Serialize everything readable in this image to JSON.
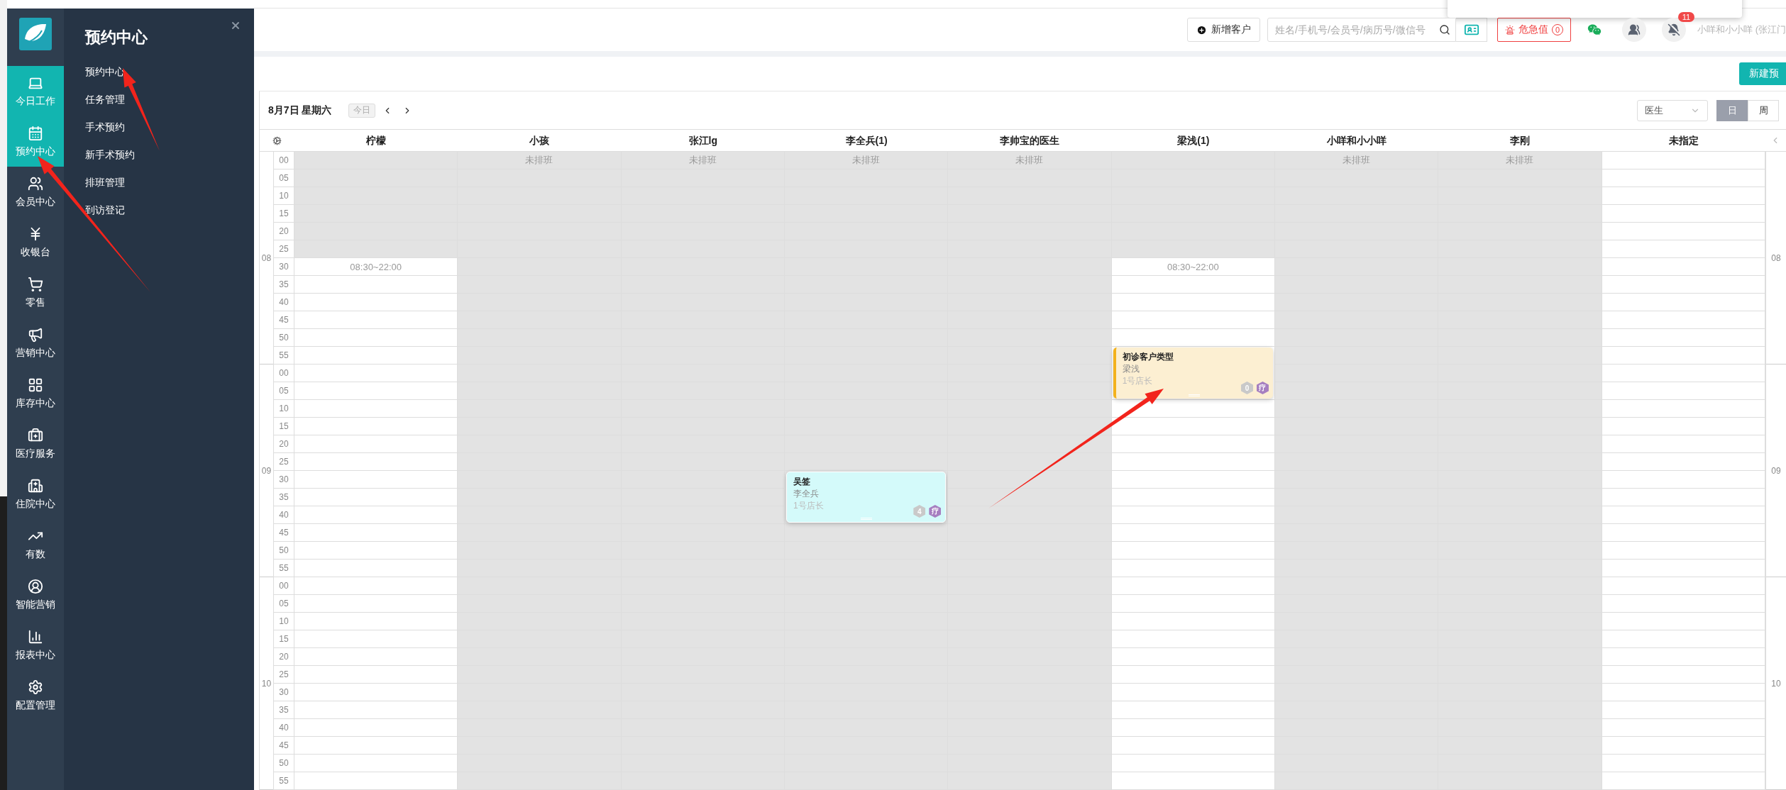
{
  "sidebar": {
    "rail": [
      {
        "label": "今日工作",
        "selected": true
      },
      {
        "label": "预约中心",
        "selected": true
      },
      {
        "label": "会员中心",
        "selected": false
      },
      {
        "label": "收银台",
        "selected": false
      },
      {
        "label": "零售",
        "selected": false
      },
      {
        "label": "营销中心",
        "selected": false
      },
      {
        "label": "库存中心",
        "selected": false
      },
      {
        "label": "医疗服务",
        "selected": false
      },
      {
        "label": "住院中心",
        "selected": false
      },
      {
        "label": "有数",
        "selected": false
      },
      {
        "label": "智能营销",
        "selected": false
      },
      {
        "label": "报表中心",
        "selected": false
      },
      {
        "label": "配置管理",
        "selected": false
      }
    ],
    "submenu": {
      "title": "预约中心",
      "items": [
        "预约中心",
        "任务管理",
        "手术预约",
        "新手术预约",
        "排班管理",
        "到访登记"
      ]
    }
  },
  "topbar": {
    "add_customer": "新增客户",
    "search": {
      "placeholder": "姓名/手机号/会员号/病历号/微信号"
    },
    "alert": {
      "label": "危急值",
      "count": "0"
    },
    "notifications": {
      "count": "11"
    },
    "user": "小咩和小小咩 (张江门"
  },
  "toolbar": {
    "new_button": "新建预"
  },
  "calendar": {
    "date": "8月7日 星期六",
    "today": {
      "label": "今日",
      "disabled": true
    },
    "view_select": "医生",
    "view_modes": [
      {
        "label": "日",
        "selected": true
      },
      {
        "label": "周",
        "selected": false
      }
    ],
    "columns": [
      {
        "name": "柠檬",
        "slots": [
          {
            "off": true
          },
          {
            "off": true
          },
          {
            "off": true
          },
          {
            "off": true
          },
          {
            "off": true
          },
          {
            "off": true
          },
          {
            "off": false,
            "note": "08:30~22:00"
          },
          {
            "off": false
          },
          {
            "off": false
          },
          {
            "off": false
          },
          {
            "off": false
          },
          {
            "off": false
          },
          {
            "off": false
          },
          {
            "off": false
          },
          {
            "off": false
          },
          {
            "off": false
          },
          {
            "off": false
          },
          {
            "off": false
          },
          {
            "off": false
          },
          {
            "off": false
          },
          {
            "off": false
          },
          {
            "off": false
          },
          {
            "off": false
          },
          {
            "off": false
          },
          {
            "off": false
          },
          {
            "off": false
          },
          {
            "off": false
          },
          {
            "off": false
          },
          {
            "off": false
          },
          {
            "off": false
          },
          {
            "off": false
          },
          {
            "off": false
          },
          {
            "off": false
          },
          {
            "off": false
          },
          {
            "off": false
          },
          {
            "off": false
          }
        ]
      },
      {
        "name": "小孩",
        "slots": [
          {
            "off": true,
            "note": "未排班"
          },
          {
            "off": true
          },
          {
            "off": true
          },
          {
            "off": true
          },
          {
            "off": true
          },
          {
            "off": true
          },
          {
            "off": true
          },
          {
            "off": true
          },
          {
            "off": true
          },
          {
            "off": true
          },
          {
            "off": true
          },
          {
            "off": true
          },
          {
            "off": true
          },
          {
            "off": true
          },
          {
            "off": true
          },
          {
            "off": true
          },
          {
            "off": true
          },
          {
            "off": true
          },
          {
            "off": true
          },
          {
            "off": true
          },
          {
            "off": true
          },
          {
            "off": true
          },
          {
            "off": true
          },
          {
            "off": true
          },
          {
            "off": true
          },
          {
            "off": true
          },
          {
            "off": true
          },
          {
            "off": true
          },
          {
            "off": true
          },
          {
            "off": true
          },
          {
            "off": true
          },
          {
            "off": true
          },
          {
            "off": true
          },
          {
            "off": true
          },
          {
            "off": true
          },
          {
            "off": true
          }
        ]
      },
      {
        "name": "张江lg",
        "slots": [
          {
            "off": true,
            "note": "未排班"
          },
          {
            "off": true
          },
          {
            "off": true
          },
          {
            "off": true
          },
          {
            "off": true
          },
          {
            "off": true
          },
          {
            "off": true
          },
          {
            "off": true
          },
          {
            "off": true
          },
          {
            "off": true
          },
          {
            "off": true
          },
          {
            "off": true
          },
          {
            "off": true
          },
          {
            "off": true
          },
          {
            "off": true
          },
          {
            "off": true
          },
          {
            "off": true
          },
          {
            "off": true
          },
          {
            "off": true
          },
          {
            "off": true
          },
          {
            "off": true
          },
          {
            "off": true
          },
          {
            "off": true
          },
          {
            "off": true
          },
          {
            "off": true
          },
          {
            "off": true
          },
          {
            "off": true
          },
          {
            "off": true
          },
          {
            "off": true
          },
          {
            "off": true
          },
          {
            "off": true
          },
          {
            "off": true
          },
          {
            "off": true
          },
          {
            "off": true
          },
          {
            "off": true
          },
          {
            "off": true
          }
        ]
      },
      {
        "name": "李全兵(1)",
        "slots": [
          {
            "off": true,
            "note": "未排班"
          },
          {
            "off": true
          },
          {
            "off": true
          },
          {
            "off": true
          },
          {
            "off": true
          },
          {
            "off": true
          },
          {
            "off": true
          },
          {
            "off": true
          },
          {
            "off": true
          },
          {
            "off": true
          },
          {
            "off": true
          },
          {
            "off": true
          },
          {
            "off": true
          },
          {
            "off": true
          },
          {
            "off": true
          },
          {
            "off": true
          },
          {
            "off": true
          },
          {
            "off": true
          },
          {
            "off": true,
            "appointment": {
              "title": "吴签",
              "doctor": "李全兵",
              "role": "1号店长",
              "count": "4",
              "tag": "疗",
              "kind": "normal",
              "color": "#d4fafa"
            }
          },
          {
            "off": true
          },
          {
            "off": true
          },
          {
            "off": true
          },
          {
            "off": true
          },
          {
            "off": true
          },
          {
            "off": true
          },
          {
            "off": true
          },
          {
            "off": true
          },
          {
            "off": true
          },
          {
            "off": true
          },
          {
            "off": true
          },
          {
            "off": true
          },
          {
            "off": true
          },
          {
            "off": true
          },
          {
            "off": true
          }
        ]
      },
      {
        "name": "李帅宝的医生",
        "slots": [
          {
            "off": true,
            "note": "未排班"
          },
          {
            "off": true
          },
          {
            "off": true
          },
          {
            "off": true
          },
          {
            "off": true
          },
          {
            "off": true
          },
          {
            "off": true
          },
          {
            "off": true
          },
          {
            "off": true
          },
          {
            "off": true
          },
          {
            "off": true
          },
          {
            "off": true
          },
          {
            "off": true
          },
          {
            "off": true
          },
          {
            "off": true
          },
          {
            "off": true
          },
          {
            "off": true
          },
          {
            "off": true
          },
          {
            "off": true
          },
          {
            "off": true
          },
          {
            "off": true
          },
          {
            "off": true
          },
          {
            "off": true
          },
          {
            "off": true
          },
          {
            "off": true
          },
          {
            "off": true
          },
          {
            "off": true
          },
          {
            "off": true
          },
          {
            "off": true
          },
          {
            "off": true
          },
          {
            "off": true
          },
          {
            "off": true
          },
          {
            "off": true
          },
          {
            "off": true
          },
          {
            "off": true
          },
          {
            "off": true
          }
        ]
      },
      {
        "name": "梁浅(1)",
        "slots": [
          {
            "off": true
          },
          {
            "off": true
          },
          {
            "off": true
          },
          {
            "off": true
          },
          {
            "off": true
          },
          {
            "off": true
          },
          {
            "off": false,
            "note": "08:30~22:00"
          },
          {
            "off": false
          },
          {
            "off": false
          },
          {
            "off": false
          },
          {
            "off": false
          },
          {
            "off": false,
            "appointment": {
              "title": "初诊客户类型",
              "doctor": "梁浅",
              "role": "1号店长",
              "count": "0",
              "tag": "疗",
              "kind": "first_visit",
              "color": "#fcefd2"
            }
          },
          {
            "off": false
          },
          {
            "off": false
          },
          {
            "off": false
          },
          {
            "off": false
          },
          {
            "off": false
          },
          {
            "off": false
          },
          {
            "off": false
          },
          {
            "off": false
          },
          {
            "off": false
          },
          {
            "off": false
          },
          {
            "off": false
          },
          {
            "off": false
          },
          {
            "off": false
          },
          {
            "off": false
          },
          {
            "off": false
          },
          {
            "off": false
          },
          {
            "off": false
          },
          {
            "off": false
          },
          {
            "off": false
          },
          {
            "off": false
          },
          {
            "off": false
          },
          {
            "off": false
          }
        ]
      },
      {
        "name": "小咩和小小咩",
        "slots": [
          {
            "off": true,
            "note": "未排班"
          },
          {
            "off": true
          },
          {
            "off": true
          },
          {
            "off": true
          },
          {
            "off": true
          },
          {
            "off": true
          },
          {
            "off": true
          },
          {
            "off": true
          },
          {
            "off": true
          },
          {
            "off": true
          },
          {
            "off": true
          },
          {
            "off": true
          },
          {
            "off": true
          },
          {
            "off": true
          },
          {
            "off": true
          },
          {
            "off": true
          },
          {
            "off": true
          },
          {
            "off": true
          },
          {
            "off": true
          },
          {
            "off": true
          },
          {
            "off": true
          },
          {
            "off": true
          },
          {
            "off": true
          },
          {
            "off": true
          },
          {
            "off": true
          },
          {
            "off": true
          },
          {
            "off": true
          },
          {
            "off": true
          },
          {
            "off": true
          },
          {
            "off": true
          },
          {
            "off": true
          },
          {
            "off": true
          },
          {
            "off": true
          },
          {
            "off": true
          },
          {
            "off": true
          },
          {
            "off": true
          }
        ]
      },
      {
        "name": "李刚",
        "slots": [
          {
            "off": true,
            "note": "未排班"
          },
          {
            "off": true
          },
          {
            "off": true
          },
          {
            "off": true
          },
          {
            "off": true
          },
          {
            "off": true
          },
          {
            "off": true
          },
          {
            "off": true
          },
          {
            "off": true
          },
          {
            "off": true
          },
          {
            "off": true
          },
          {
            "off": true
          },
          {
            "off": true
          },
          {
            "off": true
          },
          {
            "off": true
          },
          {
            "off": true
          },
          {
            "off": true
          },
          {
            "off": true
          },
          {
            "off": true
          },
          {
            "off": true
          },
          {
            "off": true
          },
          {
            "off": true
          },
          {
            "off": true
          },
          {
            "off": true
          },
          {
            "off": true
          },
          {
            "off": true
          },
          {
            "off": true
          },
          {
            "off": true
          },
          {
            "off": true
          },
          {
            "off": true
          },
          {
            "off": true
          },
          {
            "off": true
          },
          {
            "off": true
          },
          {
            "off": true
          },
          {
            "off": true
          },
          {
            "off": true
          }
        ]
      },
      {
        "name": "未指定",
        "slots": [
          {
            "off": false
          },
          {
            "off": false
          },
          {
            "off": false
          },
          {
            "off": false
          },
          {
            "off": false
          },
          {
            "off": false
          },
          {
            "off": false
          },
          {
            "off": false
          },
          {
            "off": false
          },
          {
            "off": false
          },
          {
            "off": false
          },
          {
            "off": false
          },
          {
            "off": false
          },
          {
            "off": false
          },
          {
            "off": false
          },
          {
            "off": false
          },
          {
            "off": false
          },
          {
            "off": false
          },
          {
            "off": false
          },
          {
            "off": false
          },
          {
            "off": false
          },
          {
            "off": false
          },
          {
            "off": false
          },
          {
            "off": false
          },
          {
            "off": false
          },
          {
            "off": false
          },
          {
            "off": false
          },
          {
            "off": false
          },
          {
            "off": false
          },
          {
            "off": false
          },
          {
            "off": false
          },
          {
            "off": false
          },
          {
            "off": false
          },
          {
            "off": false
          },
          {
            "off": false
          },
          {
            "off": false
          }
        ]
      }
    ],
    "hours": [
      {
        "label": "08",
        "right_label": "08",
        "minutes": [
          "00",
          "05",
          "10",
          "15",
          "20",
          "25",
          "30",
          "35",
          "40",
          "45",
          "50",
          "55"
        ]
      },
      {
        "label": "09",
        "right_label": "09",
        "minutes": [
          "00",
          "05",
          "10",
          "15",
          "20",
          "25",
          "30",
          "35",
          "40",
          "45",
          "50",
          "55"
        ]
      },
      {
        "label": "10",
        "right_label": "10",
        "minutes": [
          "00",
          "05",
          "10",
          "15",
          "20",
          "25",
          "30",
          "35",
          "40",
          "45",
          "50",
          "55"
        ]
      }
    ]
  }
}
